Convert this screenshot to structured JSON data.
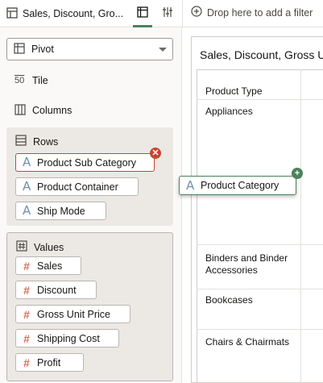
{
  "header": {
    "tab_title": "Sales, Discount, Gro...",
    "filter_placeholder": "Drop here to add a filter"
  },
  "icons": {
    "data_tab": "table-icon",
    "properties_tab": "sliders-icon",
    "filter_add": "plus-circle-icon"
  },
  "grammar": {
    "viz_type": "Pivot",
    "tile_label": "Tile",
    "tile_icon_text": "50",
    "columns_label": "Columns",
    "rows": {
      "label": "Rows",
      "items": [
        {
          "label": "Product Sub Category",
          "type": "A"
        },
        {
          "label": "Product Container",
          "type": "A"
        },
        {
          "label": "Ship Mode",
          "type": "A"
        }
      ]
    },
    "values": {
      "label": "Values",
      "items": [
        {
          "label": "Sales",
          "type": "#"
        },
        {
          "label": "Discount",
          "type": "#"
        },
        {
          "label": "Gross Unit Price",
          "type": "#"
        },
        {
          "label": "Shipping Cost",
          "type": "#"
        },
        {
          "label": "Profit",
          "type": "#"
        }
      ]
    }
  },
  "drag": {
    "label": "Product Category",
    "type": "A"
  },
  "canvas": {
    "title": "Sales, Discount, Gross U",
    "header_cell": "Product Type",
    "rows": [
      "Appliances",
      "Binders and Binder Accessories",
      "Bookcases",
      "Chairs & Chairmats"
    ]
  },
  "colors": {
    "accent_green": "#4c825c",
    "remove_red": "#c74634",
    "attribute_blue": "#6f8fb3",
    "measure_orange": "#d86f5a"
  }
}
